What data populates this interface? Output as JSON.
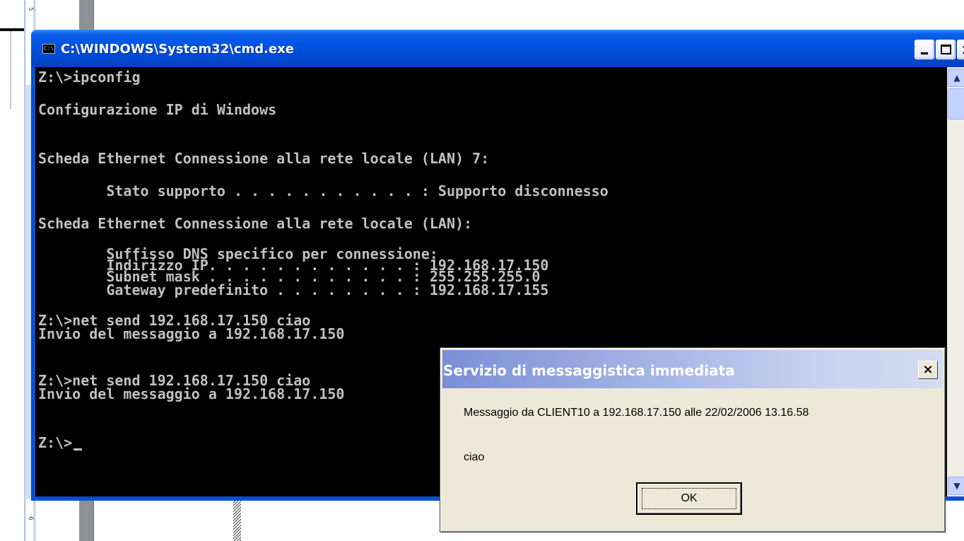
{
  "cmd_window": {
    "title": "C:\\WINDOWS\\System32\\cmd.exe",
    "icon_label": "C:\\",
    "lines": [
      "Z:\\>ipconfig",
      "",
      "Configurazione IP di Windows",
      "",
      "",
      "Scheda Ethernet Connessione alla rete locale (LAN) 7:",
      "",
      "        Stato supporto . . . . . . . . . . . : Supporto disconnesso",
      "",
      "Scheda Ethernet Connessione alla rete locale (LAN):",
      "",
      "        Suffisso DNS specifico per connessione:",
      "        Indirizzo IP. . . . . . . . . . . . : 192.168.17.150",
      "        Subnet mask . . . . . . . . . . . . : 255.255.255.0",
      "        Gateway predefinito . . . . . . . . : 192.168.17.155",
      "",
      "Z:\\>net send 192.168.17.150 ciao",
      "Invio del messaggio a 192.168.17.150",
      "",
      "",
      "Z:\\>net send 192.168.17.150 ciao",
      "Invio del messaggio a 192.168.17.150",
      "",
      "",
      "Z:\\>"
    ]
  },
  "message_dialog": {
    "title": "Servizio di messaggistica immediata",
    "header": "Messaggio da CLIENT10 a 192.168.17.150 alle 22/02/2006 13.16.58",
    "body": "ciao",
    "ok_label": "OK",
    "close_label": "×"
  },
  "ruler": {
    "top_mark": "5",
    "bottom_mark": "6"
  }
}
